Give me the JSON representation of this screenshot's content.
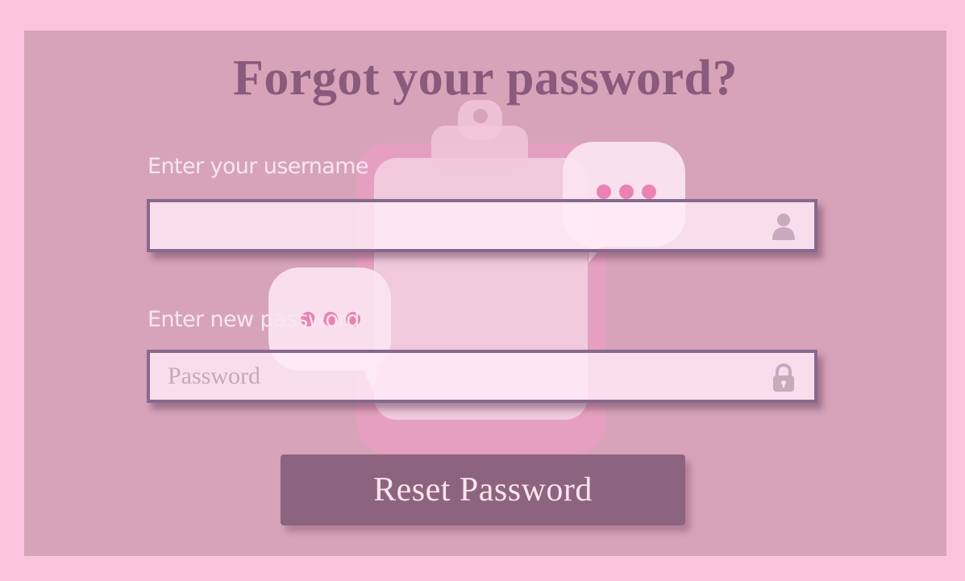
{
  "form": {
    "title": "Forgot your password?",
    "username_label": "Enter your username",
    "username_value": "",
    "username_placeholder": "",
    "password_label": "Enter new password",
    "password_value": "",
    "password_placeholder": "Password",
    "submit_label": "Reset Password"
  },
  "icons": {
    "username_icon": "user-icon",
    "password_icon": "lock-icon",
    "background": "clipboard-chat-bubbles-illustration"
  },
  "colors": {
    "page_background": "#fbc3dd",
    "panel_background": "#d6a3b9",
    "title": "#8a5a7d",
    "button": "#8d647f",
    "field_border": "#86698d"
  }
}
